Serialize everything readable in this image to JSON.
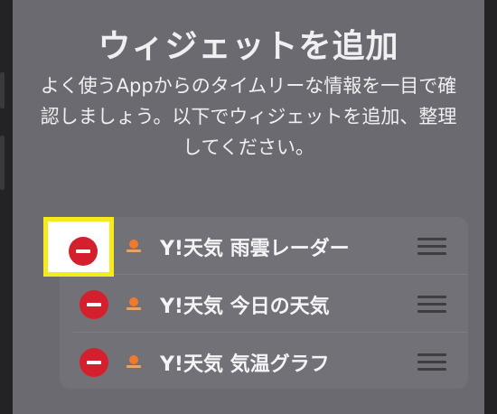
{
  "sheet": {
    "title": "ウィジェットを追加",
    "description": "よく使うAppからのタイムリーな情報を一目で確認しましょう。以下でウィジェットを追加、整理してください。"
  },
  "widgets": [
    {
      "label": "Y!天気 雨雲レーダー",
      "icon": "yahoo-weather-icon"
    },
    {
      "label": "Y!天気 今日の天気",
      "icon": "yahoo-weather-icon"
    },
    {
      "label": "Y!天気 気温グラフ",
      "icon": "yahoo-weather-icon"
    }
  ],
  "colors": {
    "delete": "#d4202c",
    "highlight": "#f7ea1a",
    "sheet": "#6a6a70"
  }
}
